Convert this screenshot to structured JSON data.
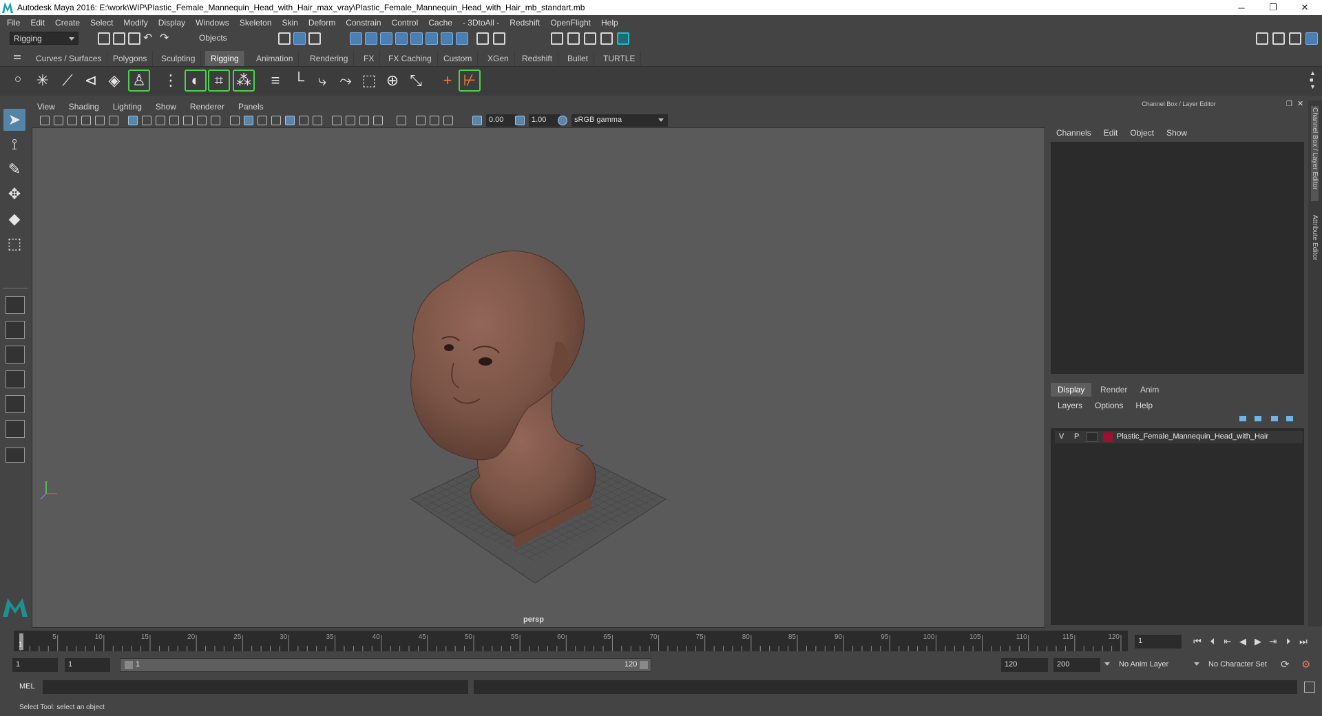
{
  "window": {
    "title": "Autodesk Maya 2016: E:\\work\\WIP\\Plastic_Female_Mannequin_Head_with_Hair_max_vray\\Plastic_Female_Mannequin_Head_with_Hair_mb_standart.mb",
    "minimize": "─",
    "restore": "❐",
    "close": "✕"
  },
  "menubar": [
    "File",
    "Edit",
    "Create",
    "Select",
    "Modify",
    "Display",
    "Windows",
    "Skeleton",
    "Skin",
    "Deform",
    "Constrain",
    "Control",
    "Cache",
    "- 3DtoAll -",
    "Redshift",
    "OpenFlight",
    "Help"
  ],
  "status_line": {
    "menu_set": "Rigging",
    "selection_mode": "Objects"
  },
  "shelf_tabs": [
    "Curves / Surfaces",
    "Polygons",
    "Sculpting",
    "Rigging",
    "Animation",
    "Rendering",
    "FX",
    "FX Caching",
    "Custom",
    "XGen",
    "Redshift",
    "Bullet",
    "TURTLE"
  ],
  "active_shelf_tab": "Rigging",
  "viewport": {
    "menu": [
      "View",
      "Shading",
      "Lighting",
      "Show",
      "Renderer",
      "Panels"
    ],
    "exposure": "0.00",
    "gamma": "1.00",
    "color_space": "sRGB gamma",
    "camera": "persp"
  },
  "channel_box": {
    "header": "Channel Box / Layer Editor",
    "menu": [
      "Channels",
      "Edit",
      "Object",
      "Show"
    ],
    "layer_tabs": [
      "Display",
      "Render",
      "Anim"
    ],
    "active_layer_tab": "Display",
    "layer_menu": [
      "Layers",
      "Options",
      "Help"
    ],
    "layers": [
      {
        "visible": "V",
        "playback": "P",
        "color": "#9e1030",
        "name": "Plastic_Female_Mannequin_Head_with_Hair"
      }
    ],
    "side_tabs": [
      "Channel Box / Layer Editor",
      "Attribute Editor"
    ]
  },
  "time_slider": {
    "ticks": [
      "5",
      "10",
      "15",
      "20",
      "25",
      "30",
      "35",
      "40",
      "45",
      "50",
      "55",
      "60",
      "65",
      "70",
      "75",
      "80",
      "85",
      "90",
      "95",
      "100",
      "105",
      "110",
      "115",
      "120"
    ],
    "start_label": "1",
    "current_frame": "1"
  },
  "range_slider": {
    "start": "1",
    "playback_start": "1",
    "bar_start": "1",
    "bar_end": "120",
    "playback_end": "120",
    "end": "200",
    "anim_layer": "No Anim Layer",
    "character_set": "No Character Set"
  },
  "command_line": {
    "label": "MEL"
  },
  "help_line": "Select Tool: select an object",
  "colors": {
    "ui_bg": "#444444",
    "viewport_bg": "#5a5a5a",
    "active_blue": "#5285a6",
    "head_skin": "#7a5446",
    "layer_color": "#9e1030"
  }
}
